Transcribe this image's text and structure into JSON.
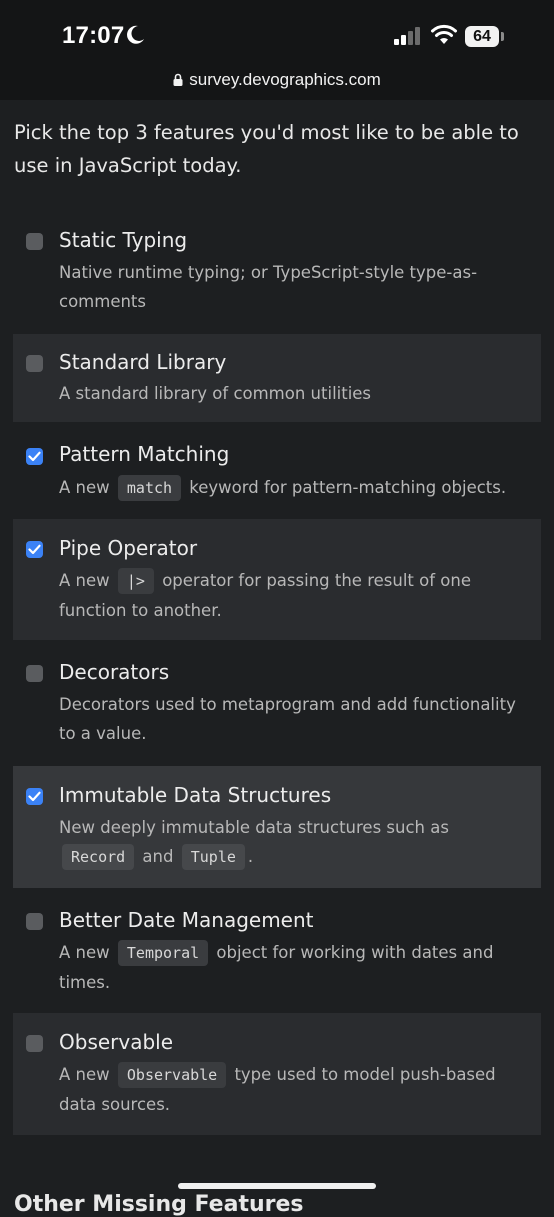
{
  "status": {
    "time": "17:07",
    "battery": "64",
    "url": "survey.devographics.com"
  },
  "question": "Pick the top 3 features you'd most like to be able to use in JavaScript today.",
  "options": [
    {
      "title": "Static Typing",
      "checked": false,
      "desc": [
        "Native runtime typing; or TypeScript-style type-as-comments"
      ]
    },
    {
      "title": "Standard Library",
      "checked": false,
      "desc": [
        "A standard library of common utilities"
      ]
    },
    {
      "title": "Pattern Matching",
      "checked": true,
      "desc": [
        "A new ",
        {
          "code": "match"
        },
        " keyword for pattern-matching objects."
      ]
    },
    {
      "title": "Pipe Operator",
      "checked": true,
      "desc": [
        "A new ",
        {
          "code": "|>"
        },
        " operator for passing the result of one function to another."
      ]
    },
    {
      "title": "Decorators",
      "checked": false,
      "desc": [
        "Decorators used to metaprogram and add functionality to a value."
      ]
    },
    {
      "title": "Immutable Data Structures",
      "checked": true,
      "desc": [
        "New deeply immutable data structures such as ",
        {
          "code": "Record"
        },
        " and ",
        {
          "code": "Tuple"
        },
        "."
      ]
    },
    {
      "title": "Better Date Management",
      "checked": false,
      "desc": [
        "A new ",
        {
          "code": "Temporal"
        },
        " object for working with dates and times."
      ]
    },
    {
      "title": "Observable",
      "checked": false,
      "desc": [
        "A new ",
        {
          "code": "Observable"
        },
        " type used to model push-based data sources."
      ]
    }
  ],
  "next_section": "Other Missing Features",
  "icons": {
    "moon": "moon-icon",
    "signal": "cellular-signal-icon",
    "wifi": "wifi-icon",
    "battery": "battery-icon",
    "lock": "lock-icon",
    "check": "checkmark-icon"
  },
  "colors": {
    "background": "#1d1f21",
    "checkbox_checked": "#3b82f6",
    "checkbox_unchecked": "#5a5c5f"
  }
}
